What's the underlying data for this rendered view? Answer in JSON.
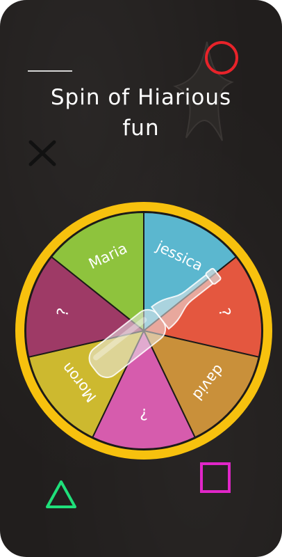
{
  "title": {
    "line1": "Spin of Hiarious",
    "line2": "fun"
  },
  "wheel": {
    "segments": [
      {
        "label": "Maria",
        "color": "#8ec33d"
      },
      {
        "label": "jessica",
        "color": "#5bb7cf"
      },
      {
        "label": "?",
        "color": "#e4573f"
      },
      {
        "label": "david",
        "color": "#c9903a"
      },
      {
        "label": "?",
        "color": "#d65cad"
      },
      {
        "label": "Moron",
        "color": "#cdb92f"
      },
      {
        "label": "?",
        "color": "#9e3a66"
      }
    ],
    "rim_color": "#f7c10e"
  },
  "icons": {
    "circle": "circle-icon",
    "cross": "cross-icon",
    "triangle": "triangle-icon",
    "square": "square-icon"
  },
  "colors": {
    "background": "#211e1d",
    "circle": "#e8232a",
    "cross": "#111111",
    "triangle": "#1fe07a",
    "square": "#e026c8"
  }
}
